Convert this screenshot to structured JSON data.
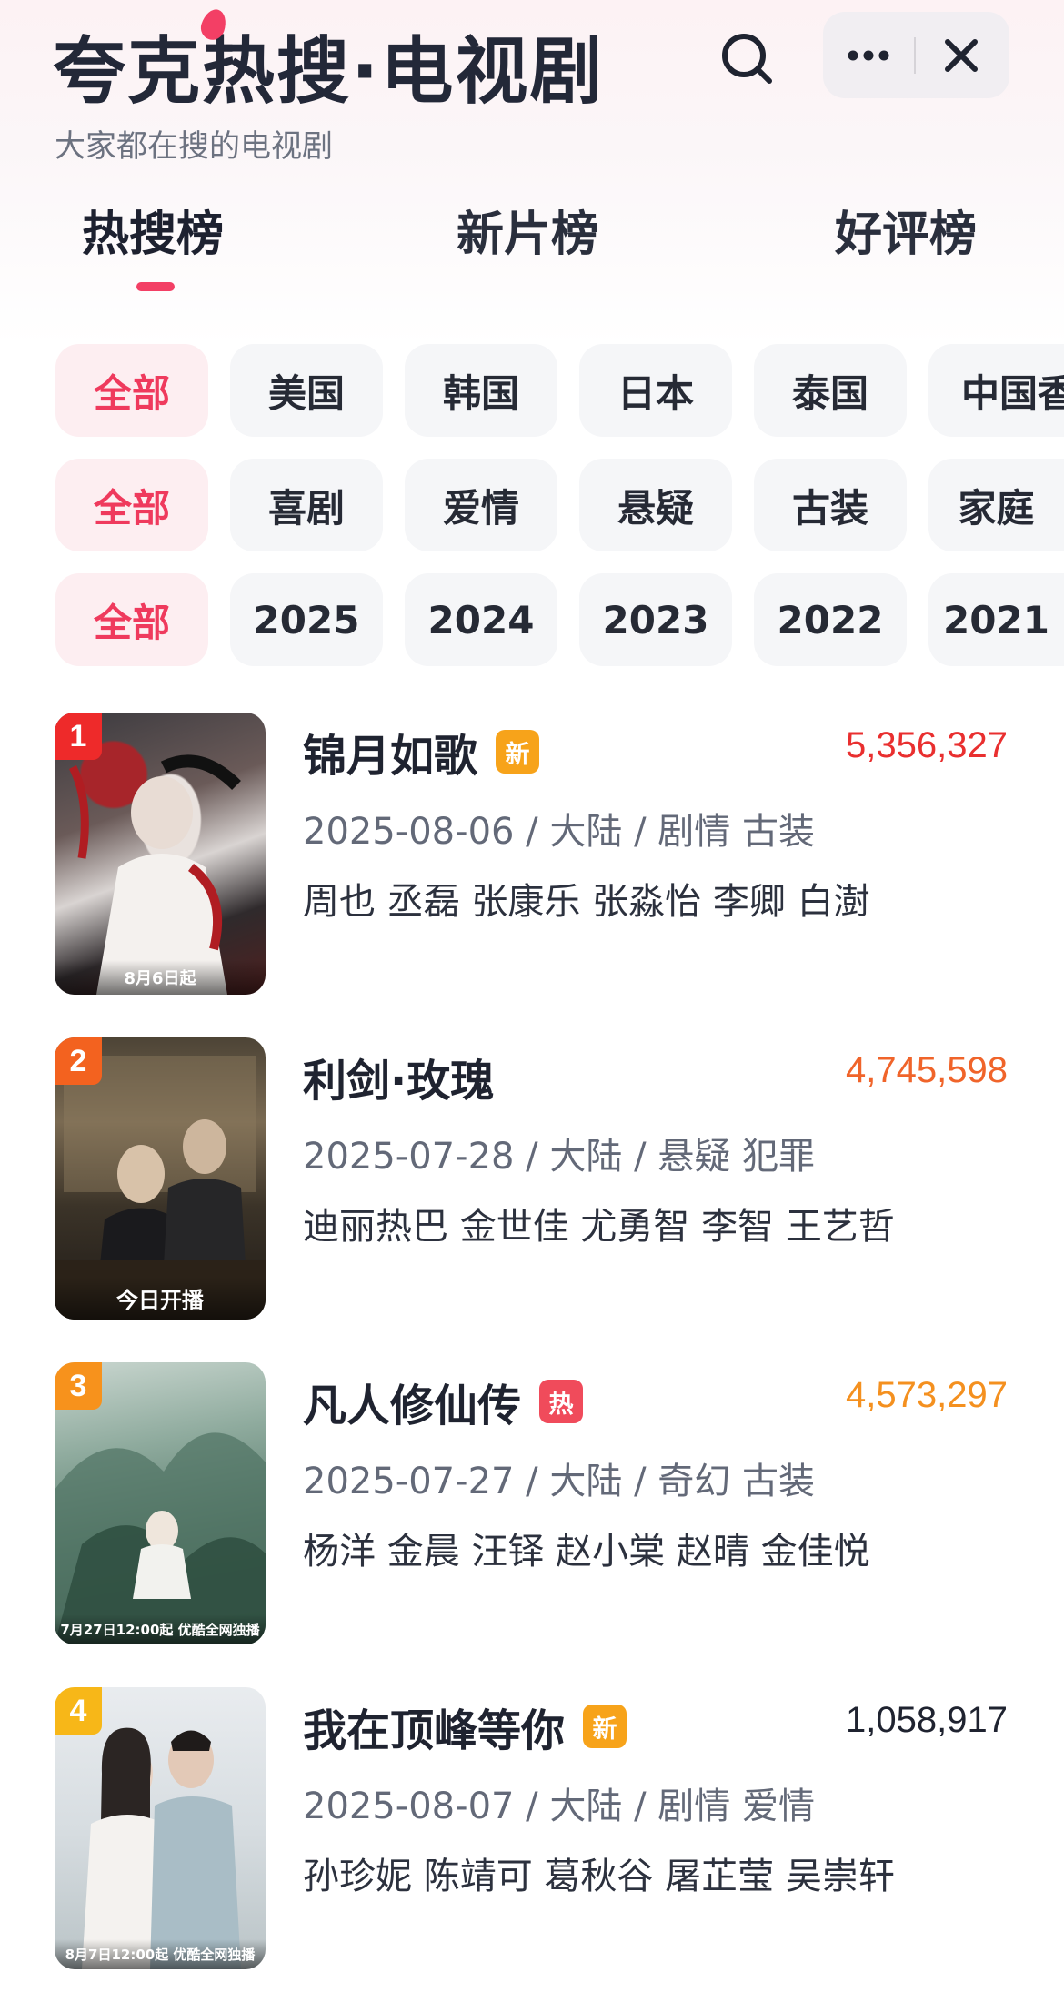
{
  "header": {
    "title": "夸克热搜·电视剧",
    "subtitle": "大家都在搜的电视剧"
  },
  "icons": {
    "search": "search-icon",
    "more": "more-horizontal-icon",
    "close": "close-icon"
  },
  "tabs": [
    {
      "label": "热搜榜",
      "active": true
    },
    {
      "label": "新片榜",
      "active": false
    },
    {
      "label": "好评榜",
      "active": false
    }
  ],
  "filters": {
    "region": [
      "全部",
      "美国",
      "韩国",
      "日本",
      "泰国",
      "中国香"
    ],
    "genre": [
      "全部",
      "喜剧",
      "爱情",
      "悬疑",
      "古装",
      "家庭"
    ],
    "year": [
      "全部",
      "2025",
      "2024",
      "2023",
      "2022",
      "2021"
    ]
  },
  "colors": {
    "accent": "#f33f65",
    "rank1": "#ee2a2a",
    "rank2": "#f3621f",
    "rank3": "#f7921c",
    "rank4": "#f7b718",
    "tag_new": "#f7a31a",
    "tag_hot": "#f04b5b"
  },
  "items": [
    {
      "rank": "1",
      "title": "锦月如歌",
      "tag": "新",
      "heat": "5,356,327",
      "heat_color": "#e92f2f",
      "meta": "2025-08-06 / 大陆 / 剧情 古装",
      "cast": "周也 丞磊 张康乐 张淼怡 李卿 白澍",
      "poster_caption": "8月6日起"
    },
    {
      "rank": "2",
      "title": "利剑·玫瑰",
      "tag": "",
      "heat": "4,745,598",
      "heat_color": "#f0642a",
      "meta": "2025-07-28 / 大陆 / 悬疑 犯罪",
      "cast": "迪丽热巴 金世佳 尤勇智 李智 王艺哲",
      "poster_caption": "今日开播"
    },
    {
      "rank": "3",
      "title": "凡人修仙传",
      "tag": "热",
      "heat": "4,573,297",
      "heat_color": "#f4901f",
      "meta": "2025-07-27 / 大陆 / 奇幻 古装",
      "cast": "杨洋 金晨 汪铎 赵小棠 赵晴 金佳悦",
      "poster_caption": "7月27日12:00起 优酷全网独播"
    },
    {
      "rank": "4",
      "title": "我在顶峰等你",
      "tag": "新",
      "heat": "1,058,917",
      "heat_color": "#1f2330",
      "meta": "2025-08-07 / 大陆 / 剧情 爱情",
      "cast": "孙珍妮 陈靖可 葛秋谷 屠芷莹 吴崇轩",
      "poster_caption": "8月7日12:00起 优酷全网独播"
    }
  ]
}
